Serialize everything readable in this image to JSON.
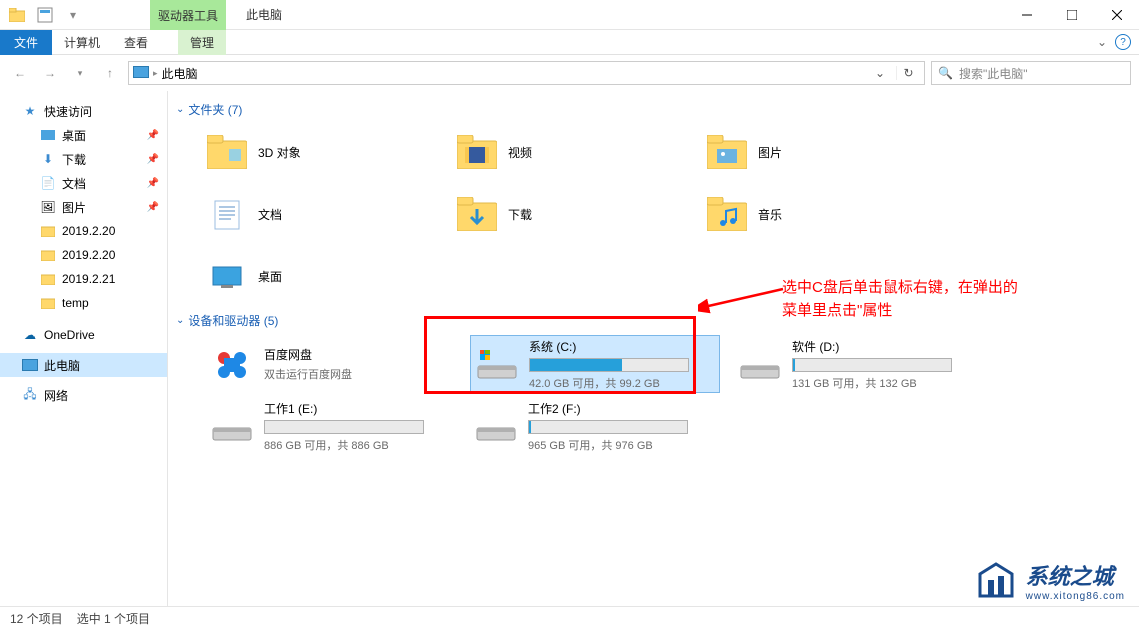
{
  "titlebar": {
    "contextual_tab_group": "驱动器工具",
    "title": "此电脑"
  },
  "ribbon": {
    "file": "文件",
    "tabs": [
      "计算机",
      "查看"
    ],
    "contextual": "管理"
  },
  "address": {
    "location": "此电脑",
    "search_placeholder": "搜索\"此电脑\""
  },
  "sidebar": {
    "quick_access": "快速访问",
    "items_pinned": [
      {
        "label": "桌面",
        "icon": "desktop"
      },
      {
        "label": "下载",
        "icon": "download"
      },
      {
        "label": "文档",
        "icon": "document"
      },
      {
        "label": "图片",
        "icon": "pictures"
      }
    ],
    "items_recent": [
      {
        "label": "2019.2.20"
      },
      {
        "label": "2019.2.20"
      },
      {
        "label": "2019.2.21"
      },
      {
        "label": "temp"
      }
    ],
    "onedrive": "OneDrive",
    "this_pc": "此电脑",
    "network": "网络"
  },
  "groups": {
    "folders": {
      "title": "文件夹 (7)",
      "items": [
        {
          "label": "3D 对象"
        },
        {
          "label": "视频"
        },
        {
          "label": "图片"
        },
        {
          "label": "文档"
        },
        {
          "label": "下载"
        },
        {
          "label": "音乐"
        },
        {
          "label": "桌面"
        }
      ]
    },
    "devices": {
      "title": "设备和驱动器 (5)",
      "baidu": {
        "name": "百度网盘",
        "sub": "双击运行百度网盘"
      },
      "drives": [
        {
          "name": "系统 (C:)",
          "stats": "42.0 GB 可用，共 99.2 GB",
          "fill_pct": 58,
          "selected": true
        },
        {
          "name": "软件 (D:)",
          "stats": "131 GB 可用，共 132 GB",
          "fill_pct": 1,
          "selected": false
        },
        {
          "name": "工作1 (E:)",
          "stats": "886 GB 可用，共 886 GB",
          "fill_pct": 0,
          "selected": false
        },
        {
          "name": "工作2 (F:)",
          "stats": "965 GB 可用，共 976 GB",
          "fill_pct": 1,
          "selected": false
        }
      ]
    }
  },
  "annotation": {
    "line1": "选中C盘后单击鼠标右键，在弹出的",
    "line2": "菜单里点击\"属性"
  },
  "statusbar": {
    "count": "12 个项目",
    "selected": "选中 1 个项目"
  },
  "watermark": {
    "text": "系统之城",
    "url": "www.xitong86.com"
  }
}
